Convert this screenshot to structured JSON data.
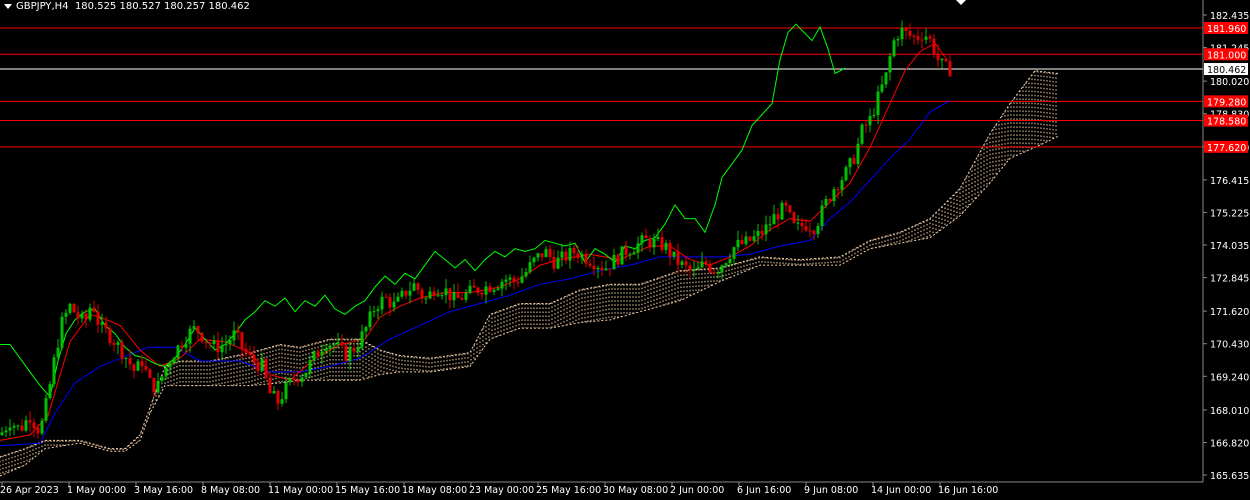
{
  "header": {
    "symbol": "GBPJPY,H4",
    "ohlc": "180.525 180.527 180.257 180.462"
  },
  "colors": {
    "background": "#000000",
    "bull": "#00c000",
    "bear": "#e00000",
    "tenkan": "#ff0000",
    "kijun": "#0000ff",
    "chikou": "#00ff00",
    "kumo": "#f5cfa8",
    "level_line": "#ff0000",
    "price_line": "#ffffff",
    "axis_text": "#ffffff"
  },
  "chart_data": {
    "type": "candlestick",
    "indicator": "ichimoku",
    "current_price": 180.462,
    "current_price_label": "180.462",
    "ylim": [
      165.635,
      182.435
    ],
    "y_ticks": [
      "182.435",
      "181.245",
      "180.020",
      "178.830",
      "177.620",
      "176.415",
      "175.225",
      "174.035",
      "172.845",
      "171.620",
      "170.430",
      "169.240",
      "168.010",
      "166.820",
      "165.635"
    ],
    "x_ticks": [
      "26 Apr 2023",
      "1 May 00:00",
      "3 May 16:00",
      "8 May 08:00",
      "11 May 00:00",
      "15 May 16:00",
      "18 May 08:00",
      "23 May 00:00",
      "25 May 16:00",
      "30 May 08:00",
      "2 Jun 00:00",
      "6 Jun 16:00",
      "9 Jun 08:00",
      "14 Jun 00:00",
      "16 Jun 16:00"
    ],
    "levels": [
      {
        "value": 181.96,
        "label": "181.960"
      },
      {
        "value": 181.0,
        "label": "181.000"
      },
      {
        "value": 179.28,
        "label": "179.280"
      },
      {
        "value": 178.58,
        "label": "178.580"
      },
      {
        "value": 177.62,
        "label": "177.620"
      }
    ],
    "candles_note": "OHLC values estimated from price axis",
    "price_path": [
      [
        0,
        167.1
      ],
      [
        10,
        167.6
      ],
      [
        20,
        167.3
      ],
      [
        30,
        167.8
      ],
      [
        40,
        167.2
      ],
      [
        48,
        168.5
      ],
      [
        55,
        170.0
      ],
      [
        62,
        171.2
      ],
      [
        70,
        171.8
      ],
      [
        78,
        171.4
      ],
      [
        85,
        171.2
      ],
      [
        92,
        172.0
      ],
      [
        100,
        171.0
      ],
      [
        108,
        170.8
      ],
      [
        115,
        170.5
      ],
      [
        125,
        170.0
      ],
      [
        135,
        169.4
      ],
      [
        142,
        169.8
      ],
      [
        150,
        169.0
      ],
      [
        157,
        168.8
      ],
      [
        165,
        169.5
      ],
      [
        172,
        170.0
      ],
      [
        180,
        170.4
      ],
      [
        188,
        170.8
      ],
      [
        196,
        171.0
      ],
      [
        205,
        170.6
      ],
      [
        215,
        170.3
      ],
      [
        225,
        170.4
      ],
      [
        235,
        170.8
      ],
      [
        243,
        170.2
      ],
      [
        252,
        169.8
      ],
      [
        262,
        169.6
      ],
      [
        270,
        168.6
      ],
      [
        278,
        168.3
      ],
      [
        286,
        168.8
      ],
      [
        295,
        169.2
      ],
      [
        305,
        169.4
      ],
      [
        315,
        170.0
      ],
      [
        325,
        170.5
      ],
      [
        335,
        170.4
      ],
      [
        345,
        170.0
      ],
      [
        355,
        170.3
      ],
      [
        365,
        170.9
      ],
      [
        375,
        171.8
      ],
      [
        385,
        172.1
      ],
      [
        395,
        171.8
      ],
      [
        405,
        172.3
      ],
      [
        415,
        172.6
      ],
      [
        425,
        172.0
      ],
      [
        435,
        172.5
      ],
      [
        445,
        172.4
      ],
      [
        455,
        172.0
      ],
      [
        465,
        172.2
      ],
      [
        475,
        172.4
      ],
      [
        485,
        172.5
      ],
      [
        495,
        172.6
      ],
      [
        505,
        172.8
      ],
      [
        515,
        172.7
      ],
      [
        525,
        173.0
      ],
      [
        535,
        173.5
      ],
      [
        545,
        173.8
      ],
      [
        555,
        173.4
      ],
      [
        565,
        173.6
      ],
      [
        575,
        173.8
      ],
      [
        585,
        173.6
      ],
      [
        595,
        173.4
      ],
      [
        605,
        173.2
      ],
      [
        615,
        173.5
      ],
      [
        625,
        173.8
      ],
      [
        635,
        174.0
      ],
      [
        645,
        174.2
      ],
      [
        655,
        174.1
      ],
      [
        665,
        174.0
      ],
      [
        675,
        173.5
      ],
      [
        685,
        173.2
      ],
      [
        695,
        173.0
      ],
      [
        705,
        173.4
      ],
      [
        715,
        173.1
      ],
      [
        725,
        173.5
      ],
      [
        735,
        174.0
      ],
      [
        745,
        174.1
      ],
      [
        755,
        174.3
      ],
      [
        765,
        174.6
      ],
      [
        775,
        175.1
      ],
      [
        785,
        175.4
      ],
      [
        795,
        174.6
      ],
      [
        805,
        174.8
      ],
      [
        815,
        174.7
      ],
      [
        825,
        175.5
      ],
      [
        835,
        176.2
      ],
      [
        845,
        176.6
      ],
      [
        855,
        177.3
      ],
      [
        862,
        178.2
      ],
      [
        870,
        178.6
      ],
      [
        878,
        179.4
      ],
      [
        886,
        180.2
      ],
      [
        893,
        181.4
      ],
      [
        900,
        181.9
      ],
      [
        908,
        181.7
      ],
      [
        916,
        181.6
      ],
      [
        924,
        181.8
      ],
      [
        932,
        181.4
      ],
      [
        938,
        180.8
      ],
      [
        944,
        180.5
      ],
      [
        950,
        180.46
      ]
    ],
    "tenkan_path": [
      [
        0,
        166.9
      ],
      [
        30,
        167.1
      ],
      [
        48,
        167.8
      ],
      [
        70,
        170.5
      ],
      [
        90,
        171.5
      ],
      [
        100,
        171.4
      ],
      [
        120,
        171.1
      ],
      [
        140,
        170.2
      ],
      [
        160,
        169.6
      ],
      [
        180,
        169.9
      ],
      [
        200,
        170.6
      ],
      [
        225,
        170.5
      ],
      [
        250,
        170.1
      ],
      [
        270,
        169.3
      ],
      [
        290,
        169.1
      ],
      [
        315,
        169.9
      ],
      [
        340,
        170.4
      ],
      [
        365,
        170.6
      ],
      [
        380,
        171.4
      ],
      [
        400,
        171.8
      ],
      [
        420,
        172.1
      ],
      [
        445,
        172.3
      ],
      [
        470,
        172.3
      ],
      [
        500,
        172.5
      ],
      [
        520,
        172.8
      ],
      [
        540,
        173.3
      ],
      [
        560,
        173.5
      ],
      [
        590,
        173.7
      ],
      [
        620,
        173.5
      ],
      [
        650,
        174.0
      ],
      [
        670,
        174.0
      ],
      [
        690,
        173.5
      ],
      [
        710,
        173.3
      ],
      [
        730,
        173.6
      ],
      [
        750,
        174.0
      ],
      [
        770,
        174.6
      ],
      [
        790,
        175.0
      ],
      [
        810,
        174.9
      ],
      [
        830,
        175.6
      ],
      [
        850,
        176.3
      ],
      [
        870,
        177.6
      ],
      [
        890,
        179.2
      ],
      [
        905,
        180.4
      ],
      [
        920,
        181.1
      ],
      [
        935,
        181.4
      ],
      [
        945,
        180.9
      ]
    ],
    "kijun_path": [
      [
        0,
        166.7
      ],
      [
        40,
        166.8
      ],
      [
        55,
        167.9
      ],
      [
        75,
        169.0
      ],
      [
        100,
        169.6
      ],
      [
        148,
        170.3
      ],
      [
        175,
        170.3
      ],
      [
        200,
        169.8
      ],
      [
        240,
        169.8
      ],
      [
        270,
        169.4
      ],
      [
        300,
        169.4
      ],
      [
        330,
        169.6
      ],
      [
        360,
        169.9
      ],
      [
        390,
        170.6
      ],
      [
        420,
        171.1
      ],
      [
        450,
        171.6
      ],
      [
        480,
        171.9
      ],
      [
        510,
        172.2
      ],
      [
        540,
        172.6
      ],
      [
        570,
        172.8
      ],
      [
        600,
        173.1
      ],
      [
        630,
        173.3
      ],
      [
        660,
        173.6
      ],
      [
        690,
        173.6
      ],
      [
        720,
        173.6
      ],
      [
        750,
        173.7
      ],
      [
        780,
        174.0
      ],
      [
        810,
        174.2
      ],
      [
        830,
        175.0
      ],
      [
        850,
        175.6
      ],
      [
        870,
        176.4
      ],
      [
        890,
        177.2
      ],
      [
        910,
        177.9
      ],
      [
        930,
        178.9
      ],
      [
        950,
        179.3
      ]
    ],
    "chikou_path": [
      [
        0,
        170.4
      ],
      [
        10,
        170.4
      ],
      [
        20,
        169.9
      ],
      [
        30,
        169.4
      ],
      [
        40,
        168.9
      ],
      [
        50,
        168.5
      ],
      [
        58,
        169.8
      ],
      [
        66,
        170.8
      ],
      [
        75,
        171.3
      ],
      [
        85,
        171.6
      ],
      [
        95,
        171.7
      ],
      [
        105,
        171.1
      ],
      [
        115,
        170.8
      ],
      [
        125,
        170.3
      ],
      [
        135,
        170.0
      ],
      [
        145,
        169.9
      ],
      [
        155,
        169.7
      ],
      [
        165,
        169.6
      ],
      [
        175,
        169.9
      ],
      [
        185,
        170.4
      ],
      [
        195,
        171.0
      ],
      [
        205,
        170.6
      ],
      [
        215,
        170.2
      ],
      [
        225,
        170.4
      ],
      [
        235,
        170.8
      ],
      [
        245,
        171.3
      ],
      [
        255,
        171.6
      ],
      [
        265,
        172.0
      ],
      [
        275,
        171.8
      ],
      [
        285,
        172.1
      ],
      [
        295,
        171.6
      ],
      [
        305,
        172.0
      ],
      [
        315,
        171.8
      ],
      [
        325,
        172.2
      ],
      [
        335,
        171.7
      ],
      [
        345,
        171.5
      ],
      [
        355,
        171.8
      ],
      [
        365,
        172.0
      ],
      [
        375,
        172.5
      ],
      [
        385,
        172.9
      ],
      [
        395,
        172.6
      ],
      [
        405,
        173.0
      ],
      [
        415,
        172.8
      ],
      [
        425,
        173.3
      ],
      [
        435,
        173.8
      ],
      [
        445,
        173.5
      ],
      [
        455,
        173.2
      ],
      [
        465,
        173.5
      ],
      [
        475,
        173.1
      ],
      [
        485,
        173.5
      ],
      [
        495,
        173.8
      ],
      [
        505,
        173.6
      ],
      [
        515,
        173.9
      ],
      [
        525,
        173.8
      ],
      [
        535,
        173.9
      ],
      [
        545,
        174.2
      ],
      [
        555,
        174.1
      ],
      [
        565,
        174.0
      ],
      [
        575,
        174.1
      ],
      [
        585,
        173.4
      ],
      [
        595,
        173.9
      ],
      [
        605,
        173.7
      ],
      [
        615,
        173.4
      ],
      [
        625,
        174.0
      ],
      [
        635,
        173.9
      ],
      [
        645,
        174.2
      ],
      [
        655,
        174.3
      ],
      [
        665,
        174.8
      ],
      [
        675,
        175.5
      ],
      [
        685,
        175.0
      ],
      [
        695,
        175.0
      ],
      [
        705,
        174.5
      ],
      [
        715,
        175.5
      ],
      [
        722,
        176.5
      ],
      [
        732,
        177.0
      ],
      [
        742,
        177.5
      ],
      [
        752,
        178.4
      ],
      [
        762,
        178.8
      ],
      [
        772,
        179.2
      ],
      [
        780,
        180.8
      ],
      [
        788,
        181.8
      ],
      [
        796,
        182.1
      ],
      [
        804,
        181.8
      ],
      [
        812,
        181.5
      ],
      [
        820,
        182.0
      ],
      [
        828,
        181.2
      ],
      [
        835,
        180.3
      ],
      [
        845,
        180.5
      ]
    ],
    "kumo_upper": [
      [
        0,
        166.3
      ],
      [
        25,
        166.6
      ],
      [
        45,
        166.9
      ],
      [
        80,
        166.9
      ],
      [
        110,
        166.6
      ],
      [
        125,
        166.6
      ],
      [
        140,
        167.1
      ],
      [
        150,
        168.1
      ],
      [
        165,
        169.6
      ],
      [
        180,
        169.8
      ],
      [
        210,
        169.8
      ],
      [
        250,
        170.1
      ],
      [
        280,
        170.4
      ],
      [
        300,
        170.3
      ],
      [
        330,
        170.6
      ],
      [
        360,
        170.6
      ],
      [
        380,
        170.2
      ],
      [
        400,
        170.0
      ],
      [
        430,
        169.9
      ],
      [
        470,
        170.1
      ],
      [
        490,
        171.5
      ],
      [
        520,
        171.9
      ],
      [
        550,
        171.9
      ],
      [
        580,
        172.4
      ],
      [
        610,
        172.6
      ],
      [
        640,
        172.6
      ],
      [
        680,
        173.1
      ],
      [
        720,
        173.2
      ],
      [
        760,
        173.6
      ],
      [
        800,
        173.5
      ],
      [
        840,
        173.6
      ],
      [
        870,
        174.2
      ],
      [
        900,
        174.5
      ],
      [
        930,
        175.0
      ],
      [
        960,
        176.1
      ],
      [
        990,
        178.1
      ],
      [
        1010,
        179.2
      ],
      [
        1035,
        180.4
      ],
      [
        1058,
        180.3
      ]
    ],
    "kumo_lower": [
      [
        0,
        165.6
      ],
      [
        25,
        166.0
      ],
      [
        45,
        166.6
      ],
      [
        80,
        166.8
      ],
      [
        110,
        166.5
      ],
      [
        125,
        166.5
      ],
      [
        140,
        166.9
      ],
      [
        150,
        167.9
      ],
      [
        165,
        168.9
      ],
      [
        180,
        168.9
      ],
      [
        210,
        168.9
      ],
      [
        250,
        168.9
      ],
      [
        280,
        169.0
      ],
      [
        300,
        169.1
      ],
      [
        330,
        169.1
      ],
      [
        360,
        169.1
      ],
      [
        380,
        169.3
      ],
      [
        400,
        169.4
      ],
      [
        430,
        169.4
      ],
      [
        470,
        169.6
      ],
      [
        490,
        170.6
      ],
      [
        520,
        171.0
      ],
      [
        550,
        171.0
      ],
      [
        580,
        171.2
      ],
      [
        610,
        171.3
      ],
      [
        640,
        171.6
      ],
      [
        680,
        172.0
      ],
      [
        720,
        172.7
      ],
      [
        760,
        173.3
      ],
      [
        800,
        173.3
      ],
      [
        840,
        173.3
      ],
      [
        870,
        173.9
      ],
      [
        900,
        174.1
      ],
      [
        930,
        174.3
      ],
      [
        960,
        175.1
      ],
      [
        990,
        176.3
      ],
      [
        1010,
        177.2
      ],
      [
        1035,
        177.6
      ],
      [
        1058,
        178.0
      ]
    ]
  }
}
